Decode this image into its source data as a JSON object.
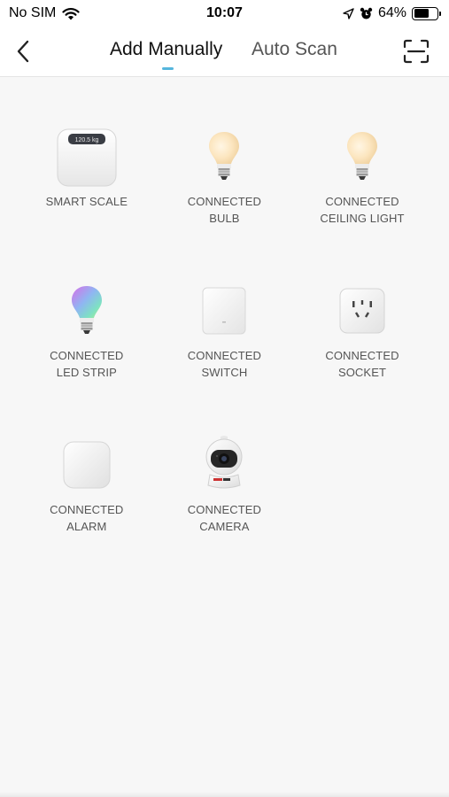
{
  "status_bar": {
    "carrier": "No SIM",
    "time": "10:07",
    "battery": "64%",
    "battery_level": 0.64
  },
  "header": {
    "tabs": [
      {
        "label": "Add Manually",
        "active": true
      },
      {
        "label": "Auto Scan",
        "active": false
      }
    ],
    "accent_color": "#55b6dd"
  },
  "devices": [
    {
      "label": "SMART SCALE",
      "icon": "smart-scale-icon",
      "display_text": "120.5 kg"
    },
    {
      "label": "CONNECTED\nBULB",
      "icon": "bulb-icon"
    },
    {
      "label": "CONNECTED\nCEILING LIGHT",
      "icon": "ceiling-light-icon"
    },
    {
      "label": "CONNECTED\nLED STRIP",
      "icon": "led-strip-icon"
    },
    {
      "label": "CONNECTED\nSWITCH",
      "icon": "switch-icon"
    },
    {
      "label": "CONNECTED\nSOCKET",
      "icon": "socket-icon"
    },
    {
      "label": "CONNECTED\nALARM",
      "icon": "alarm-icon"
    },
    {
      "label": "CONNECTED\nCAMERA",
      "icon": "camera-icon"
    }
  ]
}
